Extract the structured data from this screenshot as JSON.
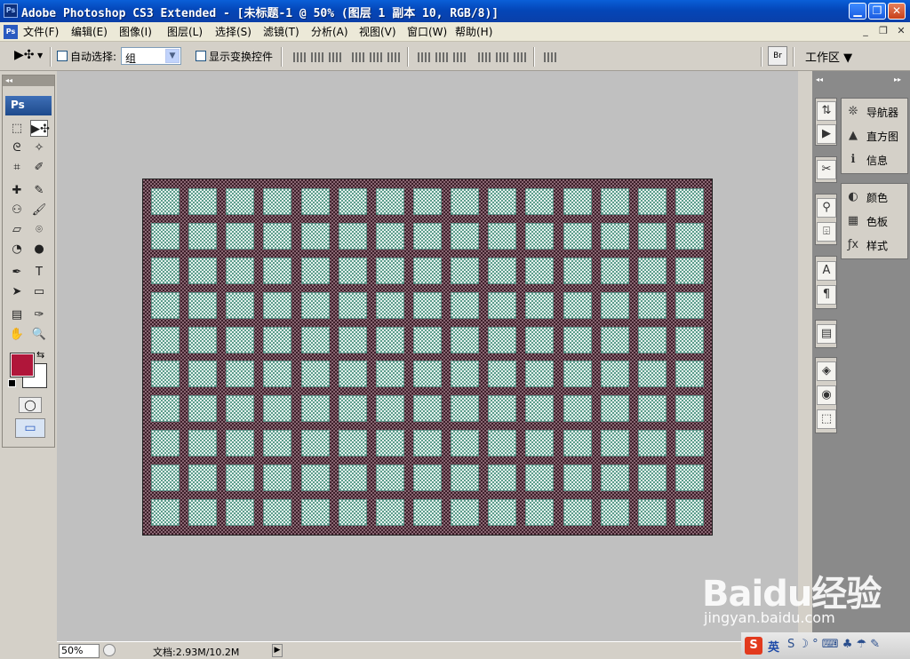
{
  "window": {
    "app_icon": "Ps",
    "title": "Adobe Photoshop CS3 Extended - [未标题-1 @ 50% (图层 1 副本 10, RGB/8)]",
    "min_glyph": "▁",
    "max_glyph": "❐",
    "close_glyph": "✕"
  },
  "menubar": {
    "doc_icon": "Ps",
    "items": [
      "文件(F)",
      "编辑(E)",
      "图像(I)",
      "图层(L)",
      "选择(S)",
      "滤镜(T)",
      "分析(A)",
      "视图(V)",
      "窗口(W)",
      "帮助(H)"
    ],
    "mdi_min": "_",
    "mdi_restore": "❐",
    "mdi_close": "✕"
  },
  "options": {
    "tool_glyph": "▶✣",
    "auto_select_label": "自动选择:",
    "auto_select_value": "组",
    "show_transform_label": "显示变换控件",
    "workspace_label": "工作区 ▼"
  },
  "toolbox": {
    "header": "◂◂",
    "logo": "Ps",
    "tools": [
      "⬚",
      "▶✣",
      "ᘓ",
      "✧",
      "⌗",
      "✐",
      "✚",
      "✎",
      "⚇",
      "🖌",
      "▱",
      "⌾",
      "◔",
      "●",
      "✒",
      "T",
      "➤",
      "▭",
      "▤",
      "✑",
      "✋",
      "🔍"
    ],
    "fg_color": "#b0163a",
    "bg_color": "#ffffff",
    "swap_glyph": "⇆",
    "mask_glyph": "◯",
    "screen_glyph": "▭"
  },
  "panels": {
    "dock_icons": [
      "⇅",
      "▶",
      "✂",
      "⚲",
      "⌹",
      "A",
      "¶",
      "▤",
      "◈",
      "◉",
      "⬚"
    ],
    "entries": [
      {
        "icon": "❊",
        "label": "导航器"
      },
      {
        "icon": "▲",
        "label": "直方图"
      },
      {
        "icon": "ℹ",
        "label": "信息"
      },
      {
        "icon": "◐",
        "label": "颜色"
      },
      {
        "icon": "▦",
        "label": "色板"
      },
      {
        "icon": "ƒx",
        "label": "样式"
      }
    ]
  },
  "statusbar": {
    "zoom": "50%",
    "doc_info": "文档:2.93M/10.2M",
    "arrow": "▶"
  },
  "canvas": {
    "grid_rows": 10,
    "grid_cols": 15
  },
  "watermark": {
    "brand": "Baidu经验",
    "url": "jingyan.baidu.com"
  },
  "taskbar": {
    "ime": "英",
    "glyphs": "S ☽ ° ⌨ ♣ ☂ ✎"
  }
}
